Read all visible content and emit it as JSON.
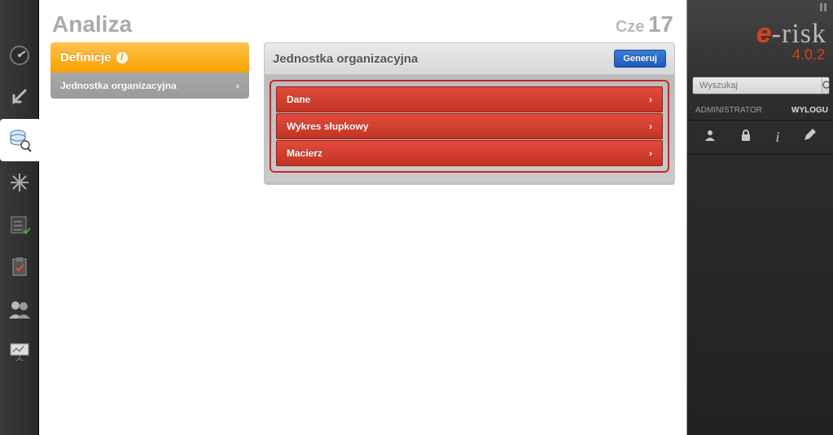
{
  "header": {
    "title": "Analiza",
    "date_month": "Cze",
    "date_day": "17"
  },
  "leftnav": {
    "definitions_label": "Definicje",
    "items": [
      {
        "label": "Jednostka organizacyjna"
      }
    ]
  },
  "panel": {
    "title": "Jednostka organizacyjna",
    "generate_label": "Generuj",
    "rows": [
      {
        "label": "Dane"
      },
      {
        "label": "Wykres słupkowy"
      },
      {
        "label": "Macierz"
      }
    ]
  },
  "sidebar": {
    "brand_prefix": "e",
    "brand_suffix": "-risk",
    "version": "4.0.2",
    "search_placeholder": "Wyszukaj",
    "user_label": "ADMINISTRATOR",
    "logout_label": "WYLOGU"
  }
}
